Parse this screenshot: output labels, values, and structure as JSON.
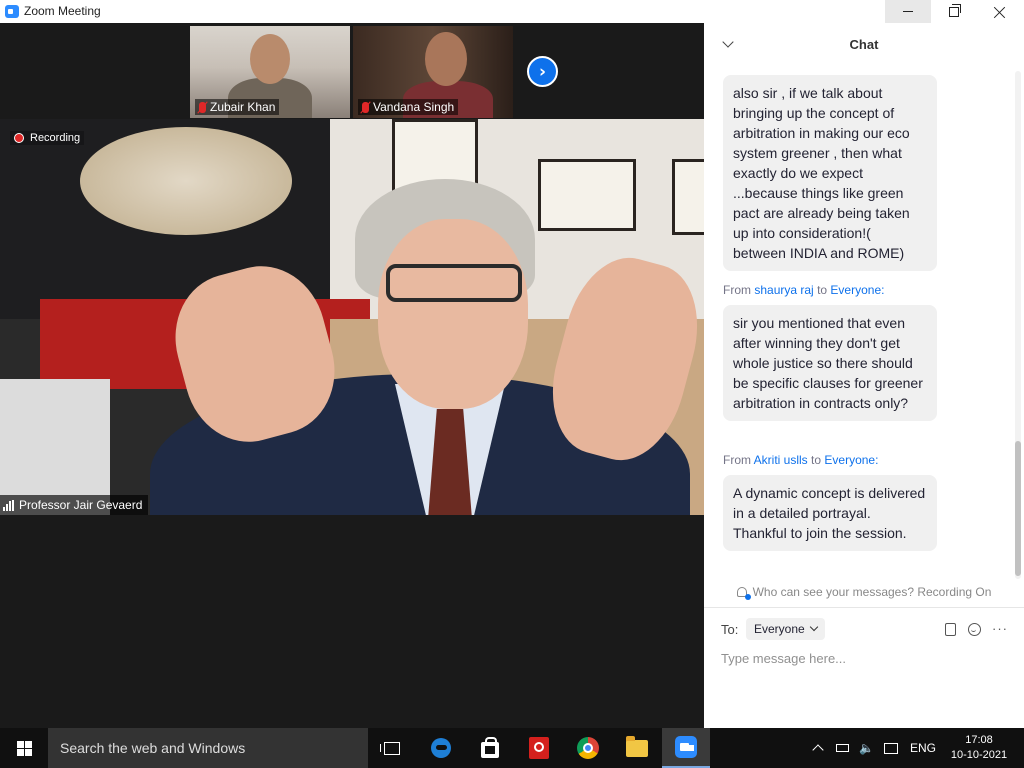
{
  "window": {
    "title": "Zoom Meeting",
    "accent": "#2d8cff"
  },
  "participants": [
    {
      "name": "Zubair Khan",
      "muted": true
    },
    {
      "name": "Vandana Singh",
      "muted": true
    }
  ],
  "speaker": {
    "name": "Professor Jair Gevaerd",
    "recording_label": "Recording"
  },
  "chat": {
    "title": "Chat",
    "messages": [
      {
        "text": "also sir , if we talk about bringing up the concept of arbitration in making our eco system greener , then what exactly do we expect ...because things like green pact are already being taken up into consideration!( between INDIA and ROME)"
      },
      {
        "from_prefix": "From",
        "sender": "shaurya raj",
        "to_word": "to",
        "recipient": "Everyone:",
        "text": "sir you mentioned that even after winning they don't get whole justice so there should be specific clauses for greener arbitration in contracts only?"
      },
      {
        "from_prefix": "From",
        "sender": "Akriti uslls",
        "to_word": "to",
        "recipient": "Everyone:",
        "text": "A dynamic concept is delivered in a detailed portrayal. Thankful to join the session."
      }
    ],
    "privacy_notice": "Who can see your messages? Recording On",
    "to_label": "To:",
    "to_selected": "Everyone",
    "input_placeholder": "Type message here..."
  },
  "taskbar": {
    "search_placeholder": "Search the web and Windows",
    "icons": [
      "task-view-icon",
      "edge-icon",
      "store-icon",
      "acrobat-icon",
      "chrome-icon",
      "file-explorer-icon",
      "zoom-icon"
    ],
    "language": "ENG",
    "time": "17:08",
    "date": "10-10-2021"
  }
}
